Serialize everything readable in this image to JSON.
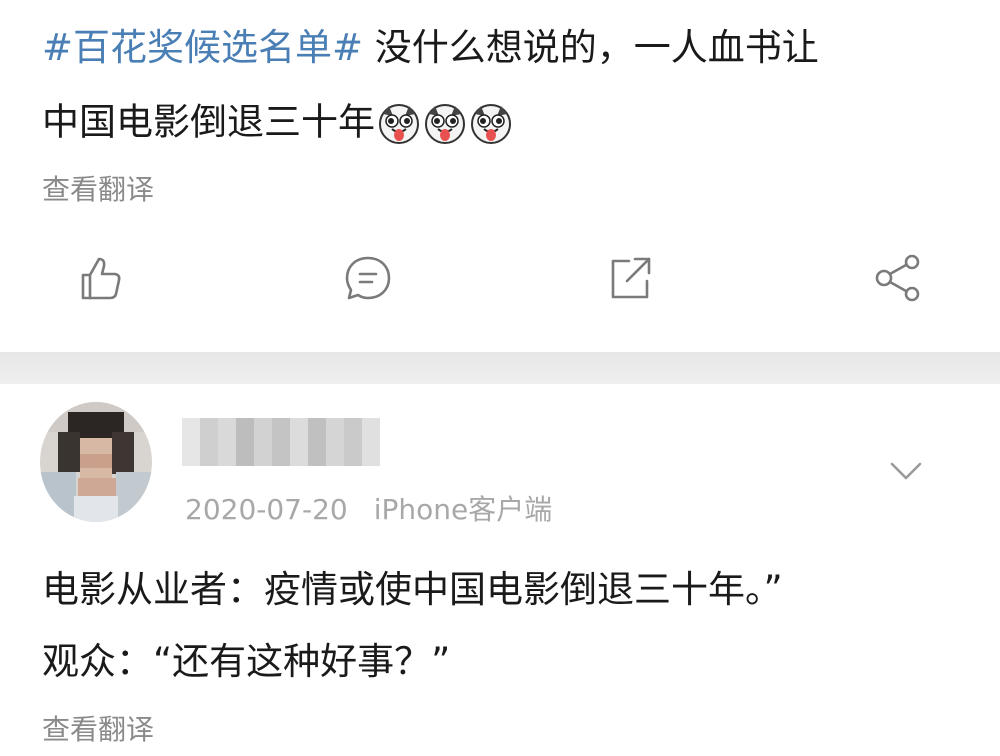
{
  "post": {
    "hashtag": "#百花奖候选名单#",
    "text_line1": " 没什么想说的，一人血书让",
    "text_line2": "中国电影倒退三十年",
    "emoji_icon": "husky-tongue-emoji",
    "emoji_count": 3,
    "translate_label": "查看翻译",
    "actions": {
      "like_icon": "thumbs-up-icon",
      "comment_icon": "comment-bubble-icon",
      "repost_icon": "repost-icon",
      "share_icon": "share-icon"
    }
  },
  "comment": {
    "username": "",
    "date": "2020-07-20",
    "source": "iPhone客户端",
    "menu_icon": "chevron-down-icon",
    "text_line1": "电影从业者：疫情或使中国电影倒退三十年。”",
    "text_line2": "观众：“还有这种好事？”",
    "translate_label": "查看翻译"
  },
  "colors": {
    "hashtag": "#4a7fb5",
    "text": "#1a1a1a",
    "secondary": "#8a8a8a",
    "icon": "#7a7a7a",
    "divider": "#ebebeb"
  }
}
